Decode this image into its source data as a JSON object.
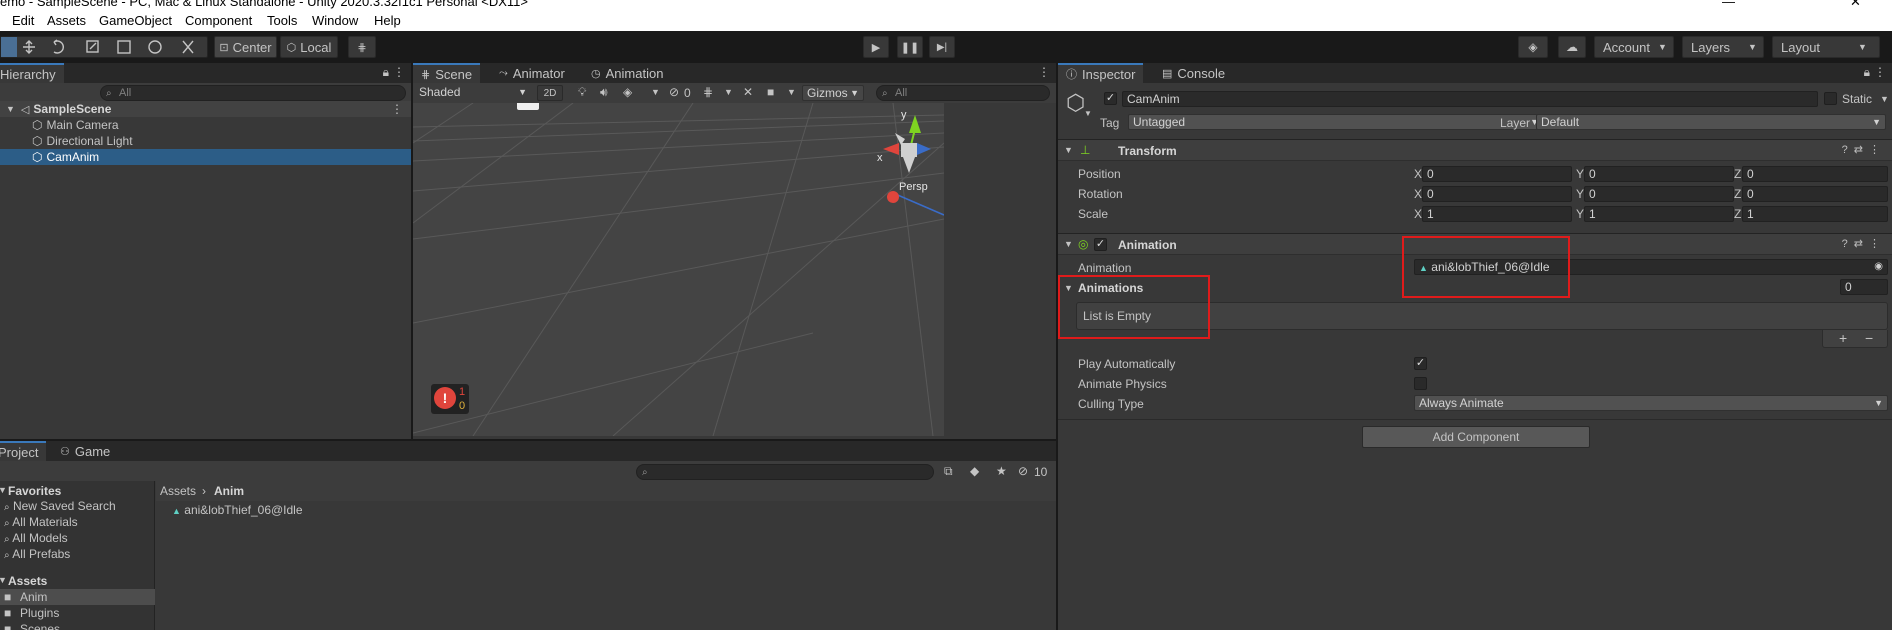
{
  "window": {
    "title": "emo - SampleScene - PC, Mac & Linux Standalone - Unity 2020.3.32f1c1 Personal <DX11>",
    "controls": {
      "minimize": "—",
      "close": "✕"
    }
  },
  "menu": {
    "items": [
      "Edit",
      "Assets",
      "GameObject",
      "Component",
      "Tools",
      "Window",
      "Help"
    ]
  },
  "toolbar": {
    "pivot_label": "Center",
    "space_label": "Local",
    "account_label": "Account",
    "layers_label": "Layers",
    "layout_label": "Layout"
  },
  "hierarchy": {
    "tab": "Hierarchy",
    "search_placeholder": "All",
    "scene": "SampleScene",
    "items": [
      "Main Camera",
      "Directional Light",
      "CamAnim"
    ]
  },
  "scene_panel": {
    "tabs": [
      "Scene",
      "Animator",
      "Animation"
    ],
    "shading": "Shaded",
    "mode_2d": "2D",
    "fx_hidden_count": "0",
    "gizmos": "Gizmos",
    "search_placeholder": "All",
    "persp_label": "Persp",
    "axis_labels": {
      "x": "x",
      "y": "y"
    },
    "error_count": "1",
    "warning_count": "0"
  },
  "inspector": {
    "tabs": [
      "Inspector",
      "Console"
    ],
    "object_name": "CamAnim",
    "static_label": "Static",
    "tag_label": "Tag",
    "tag_value": "Untagged",
    "layer_label": "Layer",
    "layer_value": "Default",
    "transform": {
      "title": "Transform",
      "rows": [
        {
          "label": "Position",
          "x": "0",
          "y": "0",
          "z": "0"
        },
        {
          "label": "Rotation",
          "x": "0",
          "y": "0",
          "z": "0"
        },
        {
          "label": "Scale",
          "x": "1",
          "y": "1",
          "z": "1"
        }
      ]
    },
    "animation": {
      "title": "Animation",
      "clip_label": "Animation",
      "clip_value": "ani&lobThief_06@Idle",
      "list_label": "Animations",
      "list_count": "0",
      "list_empty": "List is Empty",
      "play_auto_label": "Play Automatically",
      "animate_physics_label": "Animate Physics",
      "culling_label": "Culling Type",
      "culling_value": "Always Animate"
    },
    "add_component": "Add Component"
  },
  "project": {
    "tabs": [
      "Project",
      "Game"
    ],
    "hidden_packages_count": "10",
    "favorites_label": "Favorites",
    "favorites": [
      "New Saved Search",
      "All Materials",
      "All Models",
      "All Prefabs"
    ],
    "assets_label": "Assets",
    "folders": [
      "Anim",
      "Plugins",
      "Scenes"
    ],
    "breadcrumb": [
      "Assets",
      "Anim"
    ],
    "files": [
      "ani&lobThief_06@Idle"
    ]
  },
  "colors": {
    "selection": "#2c5d87",
    "highlight_box": "#e01b1b",
    "tab_accent": "#3a79bb",
    "error_red": "#e0453c"
  }
}
